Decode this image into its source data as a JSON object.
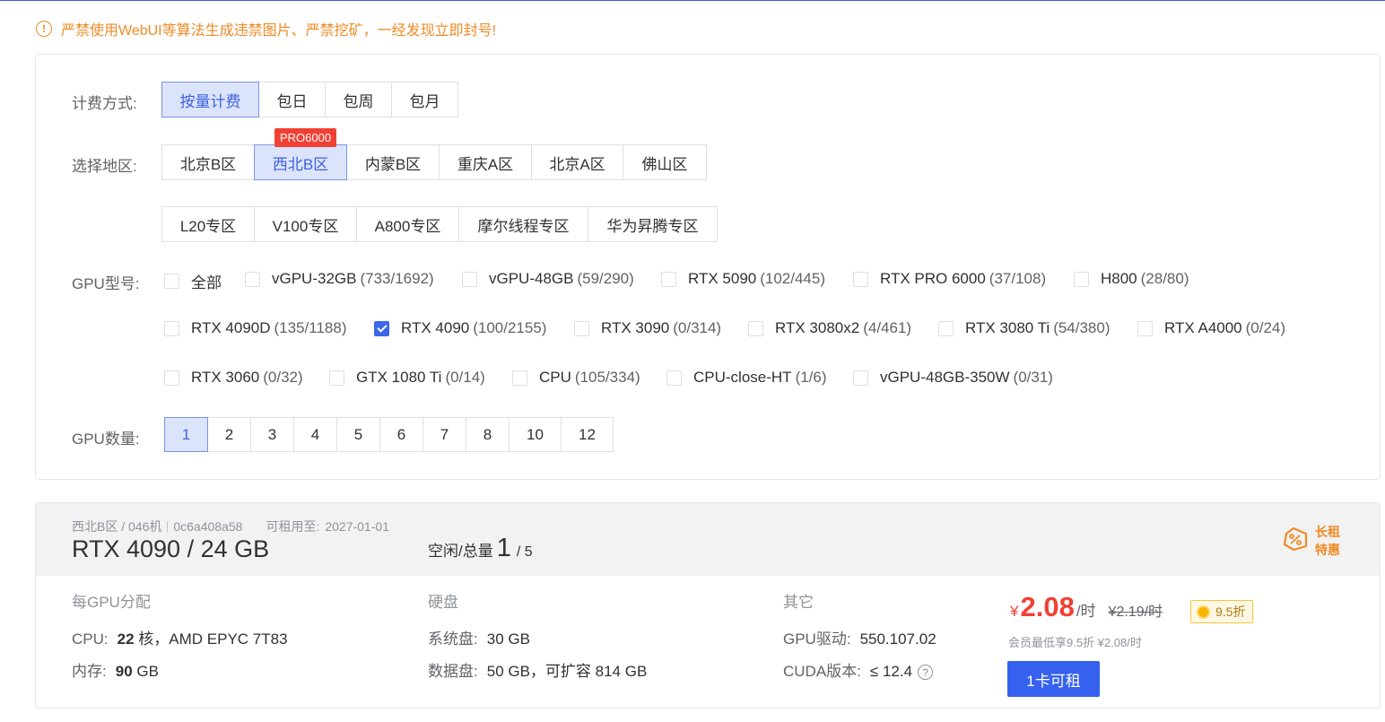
{
  "warning": {
    "icon": "exclamation-circle-icon",
    "text": "严禁使用WebUI等算法生成违禁图片、严禁挖矿，一经发现立即封号!"
  },
  "billing": {
    "label": "计费方式:",
    "options": [
      "按量计费",
      "包日",
      "包周",
      "包月"
    ],
    "selected": "按量计费"
  },
  "region": {
    "label": "选择地区:",
    "row1": [
      "北京B区",
      "西北B区",
      "内蒙B区",
      "重庆A区",
      "北京A区",
      "佛山区"
    ],
    "row2": [
      "L20专区",
      "V100专区",
      "A800专区",
      "摩尔线程专区",
      "华为昇腾专区"
    ],
    "selected": "西北B区",
    "badge": "PRO6000"
  },
  "gpu_model": {
    "label": "GPU型号:",
    "items": [
      {
        "name": "全部",
        "count": "",
        "checked": false
      },
      {
        "name": "vGPU-32GB",
        "count": "(733/1692)",
        "checked": false
      },
      {
        "name": "vGPU-48GB",
        "count": "(59/290)",
        "checked": false
      },
      {
        "name": "RTX 5090",
        "count": "(102/445)",
        "checked": false
      },
      {
        "name": "RTX PRO 6000",
        "count": "(37/108)",
        "checked": false
      },
      {
        "name": "H800",
        "count": "(28/80)",
        "checked": false
      },
      {
        "name": "RTX 4090D",
        "count": "(135/1188)",
        "checked": false
      },
      {
        "name": "RTX 4090",
        "count": "(100/2155)",
        "checked": true
      },
      {
        "name": "RTX 3090",
        "count": "(0/314)",
        "checked": false
      },
      {
        "name": "RTX 3080x2",
        "count": "(4/461)",
        "checked": false
      },
      {
        "name": "RTX 3080 Ti",
        "count": "(54/380)",
        "checked": false
      },
      {
        "name": "RTX A4000",
        "count": "(0/24)",
        "checked": false
      },
      {
        "name": "RTX 3060",
        "count": "(0/32)",
        "checked": false
      },
      {
        "name": "GTX 1080 Ti",
        "count": "(0/14)",
        "checked": false
      },
      {
        "name": "CPU",
        "count": "(105/334)",
        "checked": false
      },
      {
        "name": "CPU-close-HT",
        "count": "(1/6)",
        "checked": false
      },
      {
        "name": "vGPU-48GB-350W",
        "count": "(0/31)",
        "checked": false
      }
    ]
  },
  "gpu_count": {
    "label": "GPU数量:",
    "options": [
      "1",
      "2",
      "3",
      "4",
      "5",
      "6",
      "7",
      "8",
      "10",
      "12"
    ],
    "selected": "1"
  },
  "machine": {
    "region": "西北B区 / 046机",
    "id": "0c6a408a58",
    "expiry_label": "可租用至:",
    "expiry": "2027-01-01",
    "title": "RTX 4090 / 24 GB",
    "idle_label": "空闲/总量",
    "idle": "1",
    "total": "/ 5",
    "promo_line1": "长租",
    "promo_line2": "特惠",
    "promo_icon": "percent-tag-icon",
    "per_gpu_header": "每GPU分配",
    "cpu_label": "CPU:",
    "cpu_cores": "22",
    "cpu_unit": "核，AMD EPYC 7T83",
    "mem_label": "内存:",
    "mem_value": "90",
    "mem_unit": "GB",
    "disk_header": "硬盘",
    "sys_disk_label": "系统盘:",
    "sys_disk": "30 GB",
    "data_disk_label": "数据盘:",
    "data_disk": "50 GB，可扩容 814 GB",
    "other_header": "其它",
    "driver_label": "GPU驱动:",
    "driver": "550.107.02",
    "cuda_label": "CUDA版本:",
    "cuda": "≤ 12.4",
    "price_symbol": "¥",
    "price": "2.08",
    "price_unit": "/时",
    "orig_price": "¥2.19/时",
    "discount": "9.5折",
    "member_note": "会员最低享9.5折 ¥2.08/时",
    "rent_button": "1卡可租"
  },
  "colors": {
    "accent": "#3661f0",
    "warning": "#f08a24",
    "price": "#f04134",
    "badge": "#f04134"
  }
}
